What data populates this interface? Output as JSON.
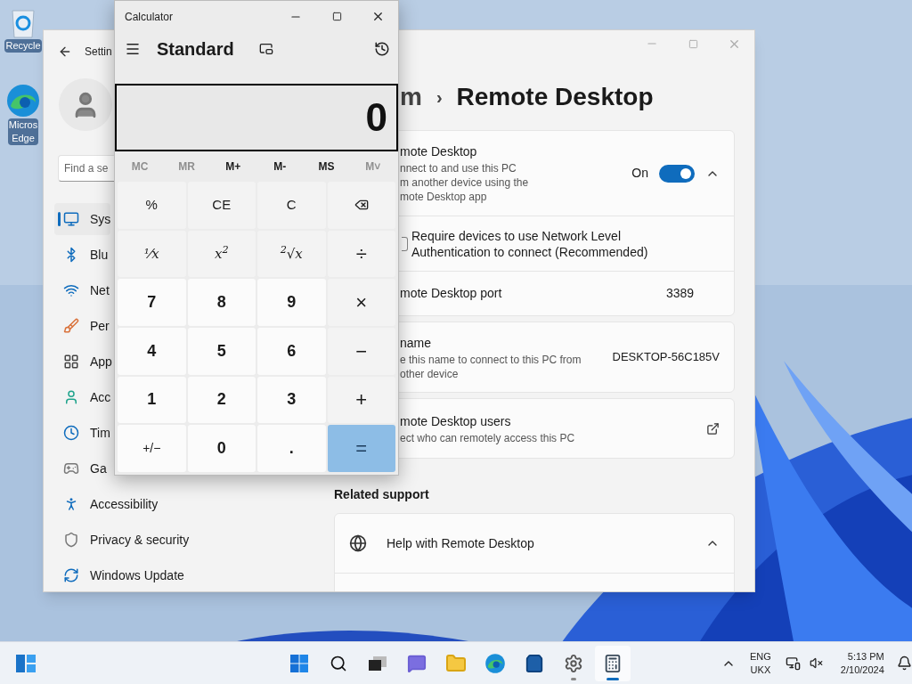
{
  "desktop_icons": [
    {
      "lines": [
        "Recycle"
      ]
    },
    {
      "lines": [
        "Micros",
        "Edge"
      ]
    }
  ],
  "settings": {
    "title": "Settin",
    "search": {
      "placeholder": "Find a se"
    },
    "nav": [
      {
        "label": "Sys",
        "selected": true
      },
      {
        "label": "Blu",
        "selected": false
      },
      {
        "label": "Net",
        "selected": false
      },
      {
        "label": "Per",
        "selected": false
      },
      {
        "label": "App",
        "selected": false
      },
      {
        "label": "Acc",
        "selected": false
      },
      {
        "label": "Tim",
        "selected": false
      },
      {
        "label": "Ga",
        "selected": false
      },
      {
        "label": "Accessibility",
        "selected": false
      },
      {
        "label": "Privacy & security",
        "selected": false
      },
      {
        "label": "Windows Update",
        "selected": false
      }
    ],
    "breadcrumb": {
      "parent": "m",
      "separator": "›",
      "page": "Remote Desktop"
    },
    "remote_desktop": {
      "title": "mote Desktop",
      "description": "nnect to and use this PC\nm another device using the\nmote Desktop app",
      "state_label": "On",
      "on": true,
      "expanded": true
    },
    "nla": {
      "label": "Require devices to use Network Level\nAuthentication to connect (Recommended)",
      "checked": false
    },
    "port": {
      "label": "mote Desktop port",
      "value": "3389"
    },
    "pc_name": {
      "title": "name",
      "description": "e this name to connect to this PC from\nother device",
      "value": "DESKTOP-56C185V"
    },
    "users": {
      "title": "mote Desktop users",
      "description": "ect who can remotely access this PC"
    },
    "related_support": {
      "heading": "Related support",
      "items": [
        {
          "label": "Help with Remote Desktop",
          "expanded": true
        }
      ]
    }
  },
  "calculator": {
    "title": "Calculator",
    "mode": "Standard",
    "display": "0",
    "memory": [
      {
        "label": "MC",
        "disabled": true
      },
      {
        "label": "MR",
        "disabled": true
      },
      {
        "label": "M+",
        "disabled": false
      },
      {
        "label": "M-",
        "disabled": false
      },
      {
        "label": "MS",
        "disabled": false
      },
      {
        "label": "M˅",
        "disabled": true
      }
    ],
    "keys": [
      {
        "label": "%",
        "kind": "function"
      },
      {
        "label": "CE",
        "kind": "function"
      },
      {
        "label": "C",
        "kind": "function"
      },
      {
        "kind": "backspace"
      },
      {
        "label": "⅟x",
        "kind": "math"
      },
      {
        "label": "x$^{2}$",
        "kind": "math"
      },
      {
        "label": "$^{2}$√x",
        "kind": "math"
      },
      {
        "label": "÷",
        "kind": "operator"
      },
      {
        "label": "7",
        "kind": "digit"
      },
      {
        "label": "8",
        "kind": "digit"
      },
      {
        "label": "9",
        "kind": "digit"
      },
      {
        "label": "×",
        "kind": "operator"
      },
      {
        "label": "4",
        "kind": "digit"
      },
      {
        "label": "5",
        "kind": "digit"
      },
      {
        "label": "6",
        "kind": "digit"
      },
      {
        "label": "−",
        "kind": "operator"
      },
      {
        "label": "1",
        "kind": "digit"
      },
      {
        "label": "2",
        "kind": "digit"
      },
      {
        "label": "3",
        "kind": "digit"
      },
      {
        "label": "+",
        "kind": "operator"
      },
      {
        "label": "+/−",
        "kind": "function-light"
      },
      {
        "label": "0",
        "kind": "digit"
      },
      {
        "label": ".",
        "kind": "digit"
      },
      {
        "label": "=",
        "kind": "equals"
      }
    ]
  },
  "taskbar": {
    "apps": [
      {
        "running": false,
        "active": false
      },
      {
        "running": false,
        "active": false
      },
      {
        "running": false,
        "active": false
      },
      {
        "running": false,
        "active": false
      },
      {
        "running": false,
        "active": false
      },
      {
        "running": false,
        "active": false
      },
      {
        "running": false,
        "active": false
      },
      {
        "running": true,
        "active": false
      },
      {
        "running": true,
        "active": true
      }
    ],
    "language": [
      "ENG",
      "UKX"
    ],
    "time": "5:13 PM",
    "date": "2/10/2024"
  }
}
